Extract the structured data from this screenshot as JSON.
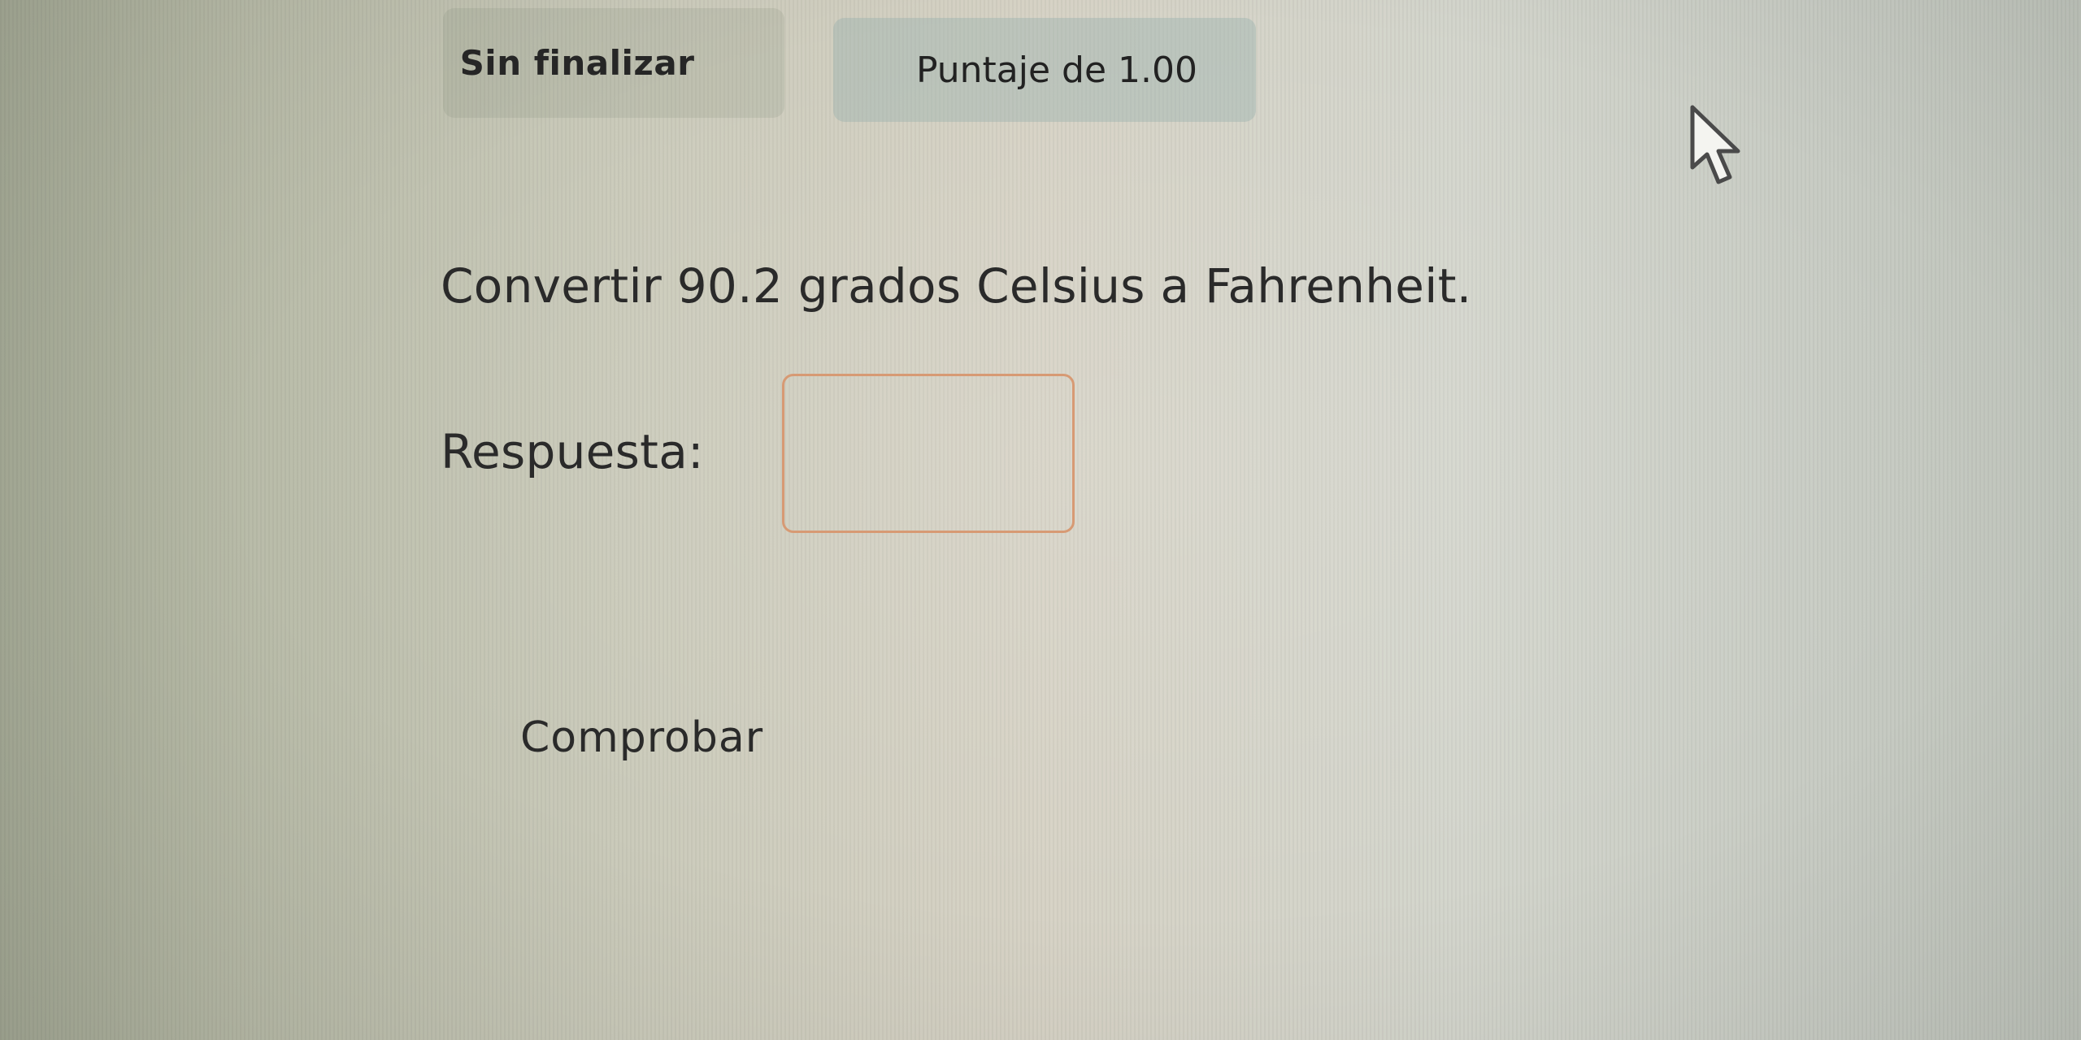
{
  "header": {
    "status_label": "Sin finalizar",
    "score_label": "Puntaje de 1.00"
  },
  "question": {
    "text": "Convertir 90.2 grados Celsius a Fahrenheit."
  },
  "answer": {
    "label": "Respuesta:",
    "value": ""
  },
  "actions": {
    "check_label": "Comprobar"
  },
  "icons": {
    "cursor": "mouse-pointer-icon"
  },
  "colors": {
    "input_border": "#d79a74",
    "score_background": "#96afac",
    "text": "#2a2a2a"
  }
}
